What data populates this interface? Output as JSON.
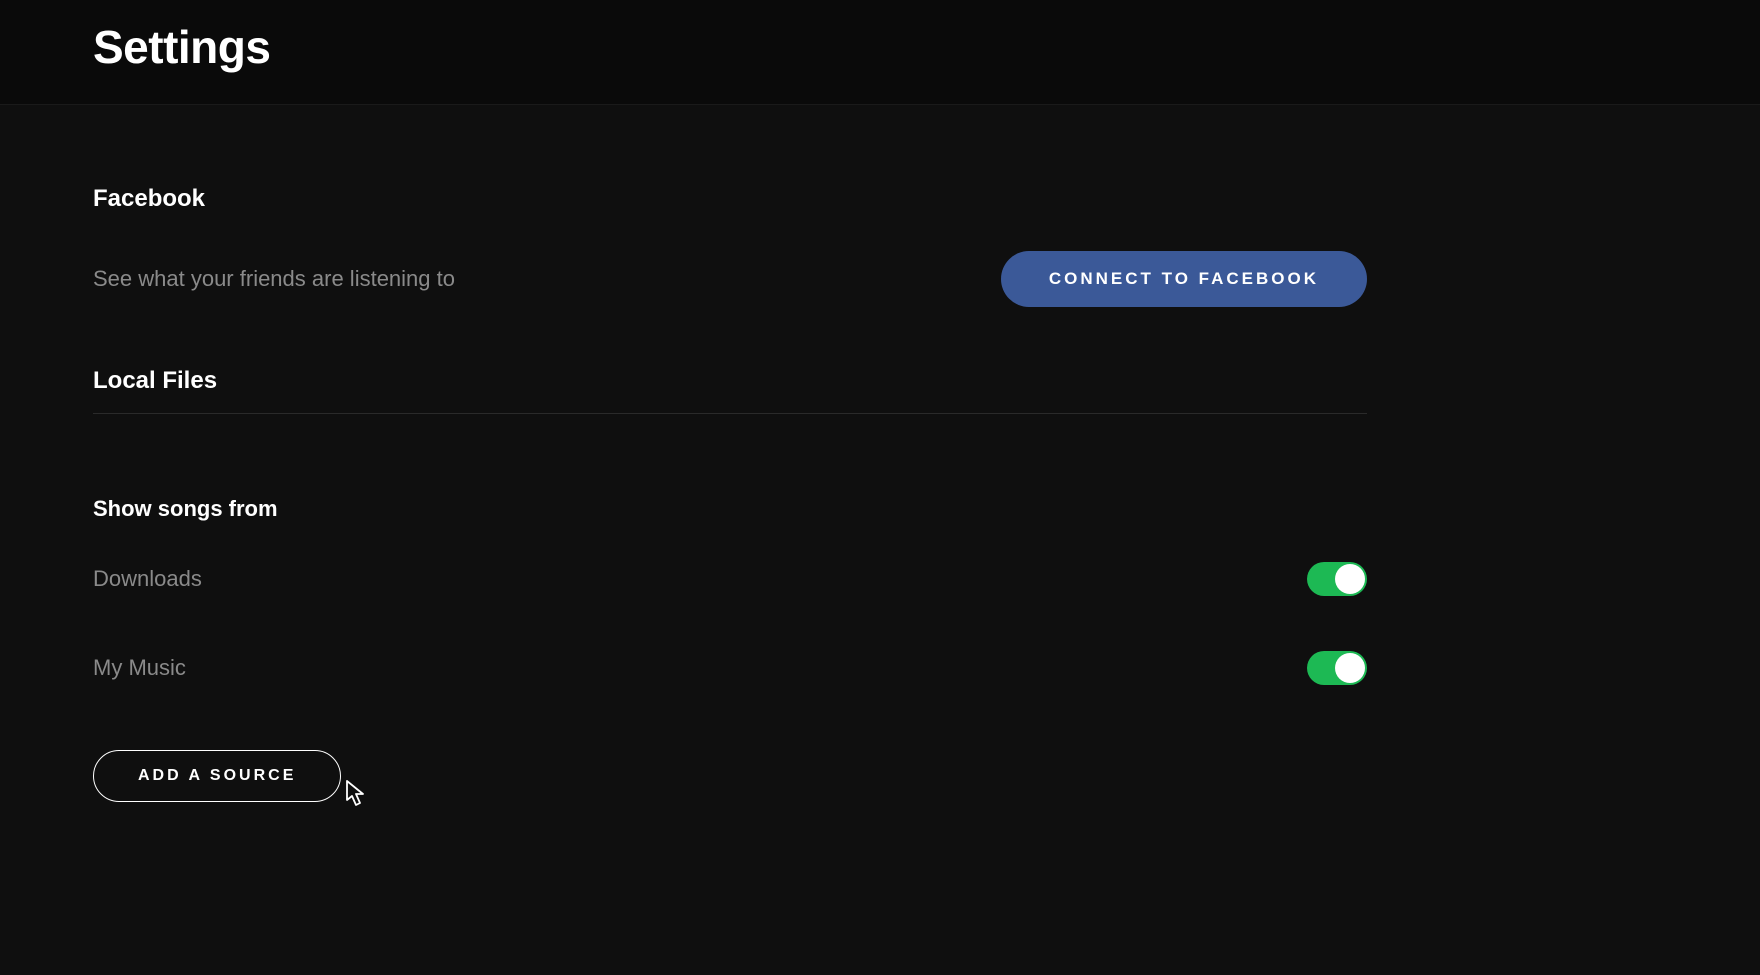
{
  "header": {
    "title": "Settings"
  },
  "facebook": {
    "heading": "Facebook",
    "description": "See what your friends are listening to",
    "button_label": "CONNECT TO FACEBOOK"
  },
  "local_files": {
    "heading": "Local Files",
    "subheading": "Show songs from",
    "sources": [
      {
        "label": "Downloads",
        "enabled": true
      },
      {
        "label": "My Music",
        "enabled": true
      }
    ],
    "add_button_label": "ADD A SOURCE"
  },
  "colors": {
    "facebook_blue": "#3b5998",
    "toggle_green": "#1db954"
  }
}
